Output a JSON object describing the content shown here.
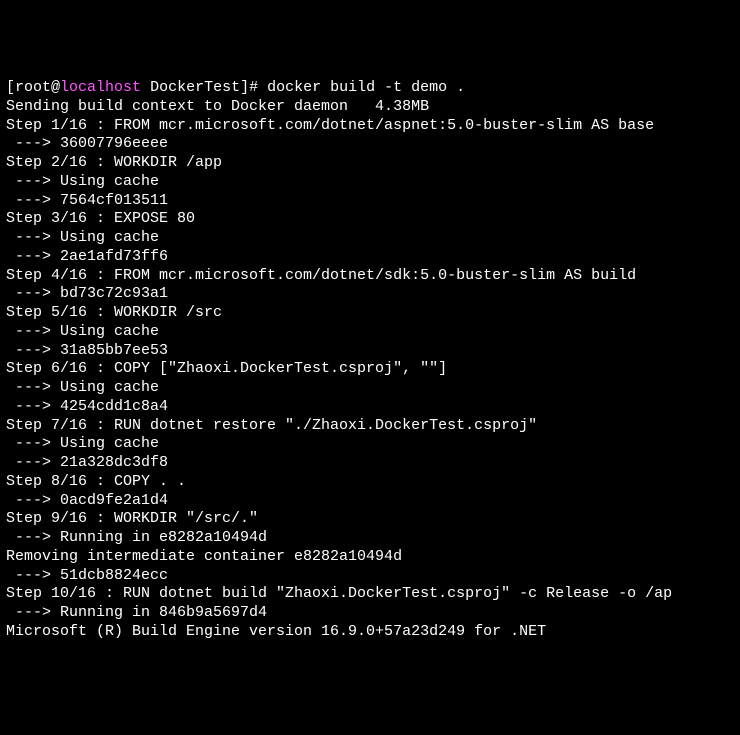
{
  "prompt": {
    "user": "root",
    "at": "@",
    "host": "localhost",
    "directory": " DockerTest",
    "hash": "]# "
  },
  "command": "docker build -t demo .",
  "lines": [
    "Sending build context to Docker daemon   4.38MB",
    "Step 1/16 : FROM mcr.microsoft.com/dotnet/aspnet:5.0-buster-slim AS base",
    " ---> 36007796eeee",
    "Step 2/16 : WORKDIR /app",
    " ---> Using cache",
    " ---> 7564cf013511",
    "Step 3/16 : EXPOSE 80",
    " ---> Using cache",
    " ---> 2ae1afd73ff6",
    "Step 4/16 : FROM mcr.microsoft.com/dotnet/sdk:5.0-buster-slim AS build",
    " ---> bd73c72c93a1",
    "Step 5/16 : WORKDIR /src",
    " ---> Using cache",
    " ---> 31a85bb7ee53",
    "Step 6/16 : COPY [\"Zhaoxi.DockerTest.csproj\", \"\"]",
    " ---> Using cache",
    " ---> 4254cdd1c8a4",
    "Step 7/16 : RUN dotnet restore \"./Zhaoxi.DockerTest.csproj\"",
    " ---> Using cache",
    " ---> 21a328dc3df8",
    "Step 8/16 : COPY . .",
    " ---> 0acd9fe2a1d4",
    "Step 9/16 : WORKDIR \"/src/.\"",
    " ---> Running in e8282a10494d",
    "Removing intermediate container e8282a10494d",
    " ---> 51dcb8824ecc",
    "Step 10/16 : RUN dotnet build \"Zhaoxi.DockerTest.csproj\" -c Release -o /ap",
    " ---> Running in 846b9a5697d4",
    "Microsoft (R) Build Engine version 16.9.0+57a23d249 for .NET"
  ]
}
